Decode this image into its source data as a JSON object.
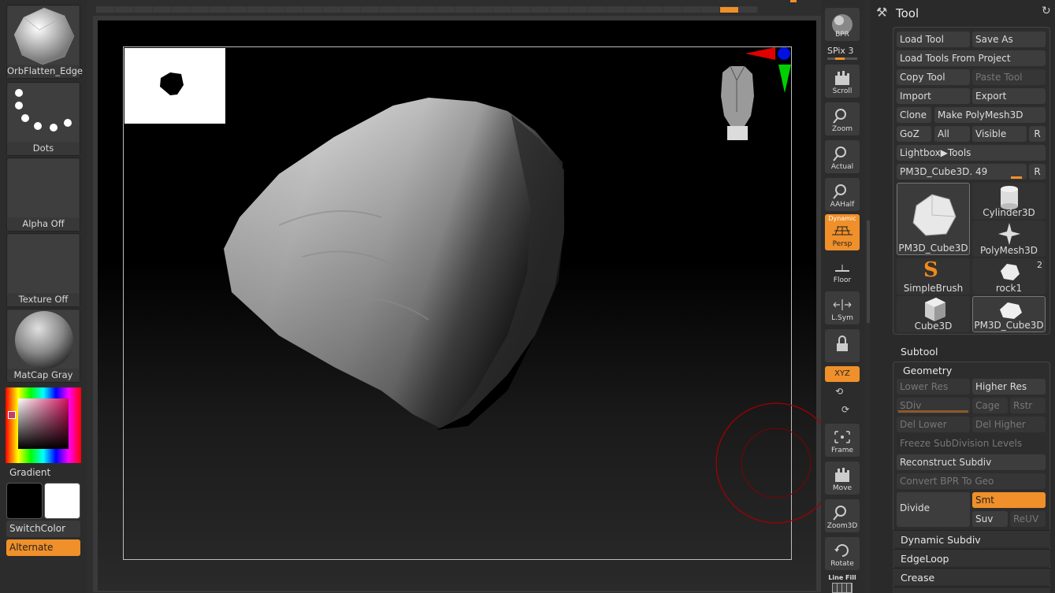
{
  "left_shelf": {
    "brush": "OrbFlatten_Edge",
    "stroke": "Dots",
    "alpha": "Alpha Off",
    "texture": "Texture Off",
    "material": "MatCap Gray",
    "gradient": "Gradient",
    "switch_color": "SwitchColor",
    "alternate": "Alternate"
  },
  "right_shelf": {
    "bpr": "BPR",
    "spix_label": "SPix",
    "spix_value": "3",
    "scroll": "Scroll",
    "zoom": "Zoom",
    "actual": "Actual",
    "aahalf": "AAHalf",
    "dynamic": "Dynamic",
    "persp": "Persp",
    "floor": "Floor",
    "lsym": "L.Sym",
    "xyz": "XYZ",
    "frame": "Frame",
    "move": "Move",
    "zoom3d": "Zoom3D",
    "rotate": "Rotate",
    "linefill": "Line Fill"
  },
  "tool": {
    "title": "Tool",
    "load_tool": "Load Tool",
    "save_as": "Save As",
    "load_from_project": "Load Tools From Project",
    "copy_tool": "Copy Tool",
    "paste_tool": "Paste Tool",
    "import": "Import",
    "export": "Export",
    "clone": "Clone",
    "make_polymesh": "Make PolyMesh3D",
    "goz": "GoZ",
    "all": "All",
    "visible": "Visible",
    "r": "R",
    "lightbox_tools": "Lightbox▶Tools",
    "current_tool": "PM3D_Cube3D. 49",
    "current_tool_slider": 0.93,
    "tiles": [
      {
        "label": "PM3D_Cube3D",
        "badge": ""
      },
      {
        "label": "Cylinder3D",
        "badge": ""
      },
      {
        "label": "PolyMesh3D",
        "badge": ""
      },
      {
        "label": "SimpleBrush",
        "badge": ""
      },
      {
        "label": "rock1",
        "badge": "2"
      },
      {
        "label": "Cube3D",
        "badge": ""
      },
      {
        "label": "PM3D_Cube3D",
        "badge": ""
      }
    ]
  },
  "subtool": {
    "label": "Subtool"
  },
  "geometry": {
    "label": "Geometry",
    "lower_res": "Lower Res",
    "higher_res": "Higher Res",
    "sdiv": "SDiv",
    "cage": "Cage",
    "rstr": "Rstr",
    "del_lower": "Del Lower",
    "del_higher": "Del Higher",
    "freeze": "Freeze SubDivision Levels",
    "reconstruct": "Reconstruct Subdiv",
    "convert_bpr": "Convert BPR To Geo",
    "divide": "Divide",
    "smt": "Smt",
    "suv": "Suv",
    "reuv": "ReUV",
    "dynamic_subdiv": "Dynamic Subdiv",
    "edgeloop": "EdgeLoop",
    "crease": "Crease"
  },
  "colors": {
    "accent": "#f0902a",
    "panel": "#2d2d2d",
    "button": "#3d3d3d"
  }
}
